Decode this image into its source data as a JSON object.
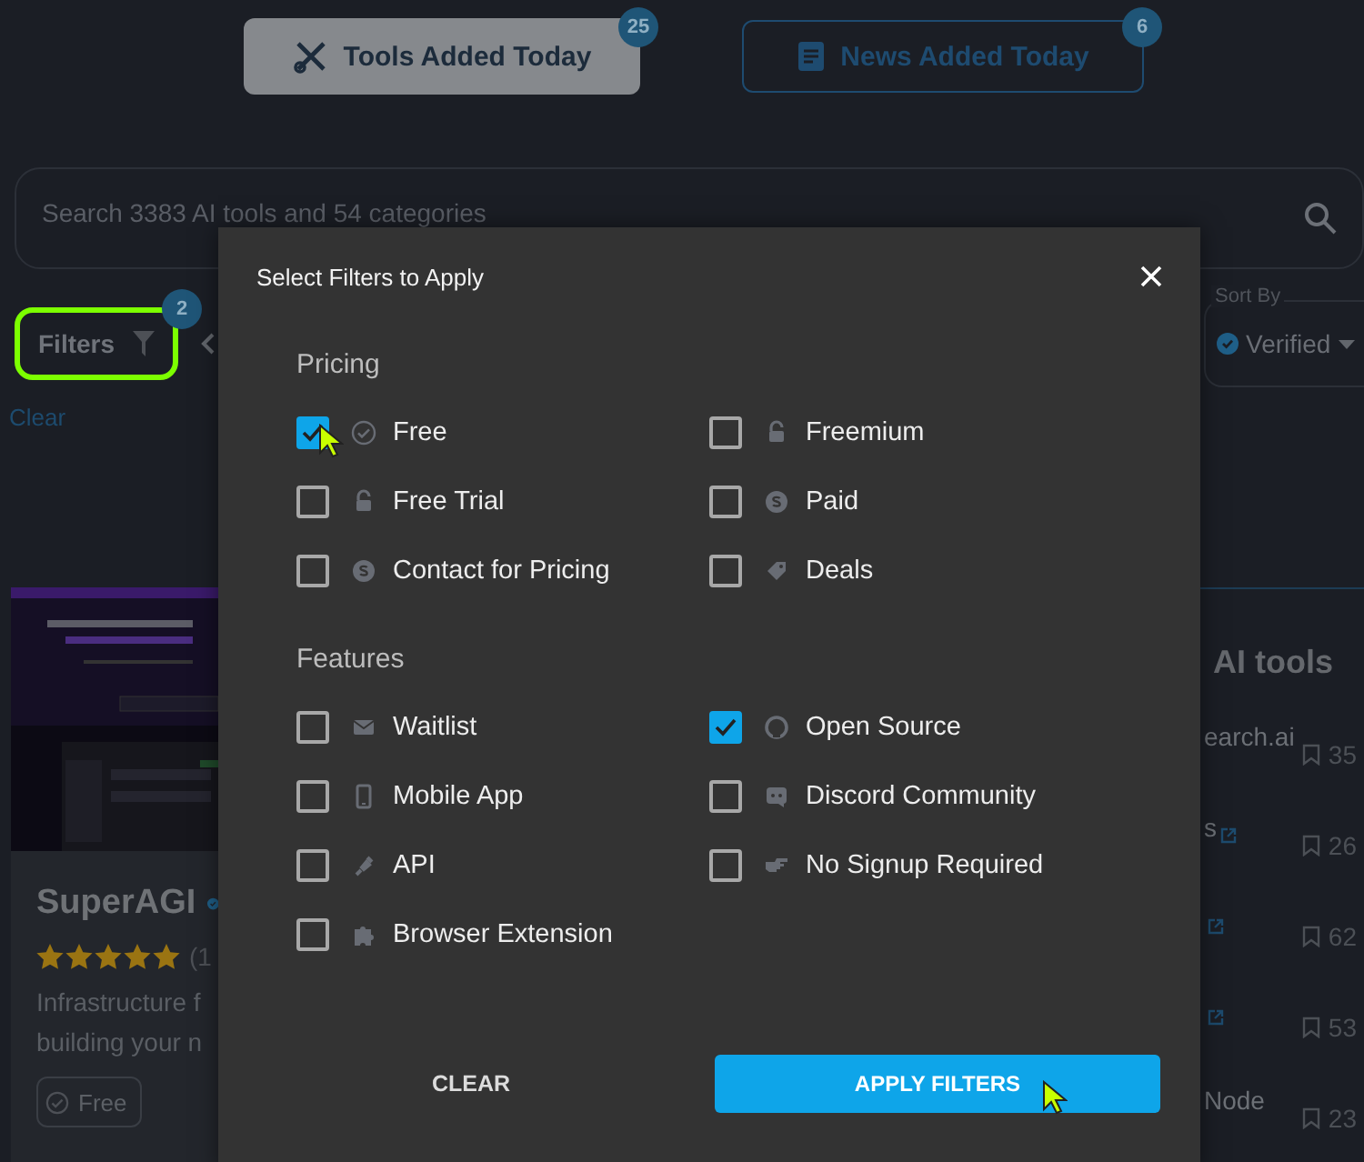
{
  "header_buttons": [
    {
      "label": "Tools Added Today",
      "count": "25",
      "selected": true
    },
    {
      "label": "News Added Today",
      "count": "6",
      "selected": false
    }
  ],
  "search": {
    "placeholder": "Search 3383 AI tools and 54 categories"
  },
  "filters_button": {
    "label": "Filters",
    "count": "2",
    "highlighted": true
  },
  "clear_link": "Clear",
  "sort": {
    "legend": "Sort By",
    "value": "Verified"
  },
  "tool_card": {
    "name": "SuperAGI",
    "stars": 5,
    "review_count": "(1",
    "description": [
      "Infrastructure f",
      "building your n"
    ],
    "tag": "Free"
  },
  "side_list": {
    "title": "AI tools",
    "items": [
      {
        "name": "earch.ai",
        "saves": "35",
        "link": false
      },
      {
        "name": "s",
        "saves": "26",
        "link": true
      },
      {
        "saves": "62",
        "link": true
      },
      {
        "saves": "53",
        "link": true
      },
      {
        "name": "Node",
        "saves": "23",
        "link": false
      }
    ]
  },
  "modal": {
    "title": "Select Filters to Apply",
    "sections": [
      {
        "title": "Pricing",
        "options": [
          {
            "label": "Free",
            "checked": true
          },
          {
            "label": "Freemium",
            "checked": false
          },
          {
            "label": "Free Trial",
            "checked": false
          },
          {
            "label": "Paid",
            "checked": false
          },
          {
            "label": "Contact for Pricing",
            "checked": false
          },
          {
            "label": "Deals",
            "checked": false
          }
        ]
      },
      {
        "title": "Features",
        "options": [
          {
            "label": "Waitlist",
            "checked": false
          },
          {
            "label": "Open Source",
            "checked": true
          },
          {
            "label": "Mobile App",
            "checked": false
          },
          {
            "label": "Discord Community",
            "checked": false
          },
          {
            "label": "API",
            "checked": false
          },
          {
            "label": "No Signup Required",
            "checked": false
          },
          {
            "label": "Browser Extension",
            "checked": false
          }
        ]
      }
    ],
    "clear_button": "CLEAR",
    "apply_button": "APPLY FILTERS"
  }
}
